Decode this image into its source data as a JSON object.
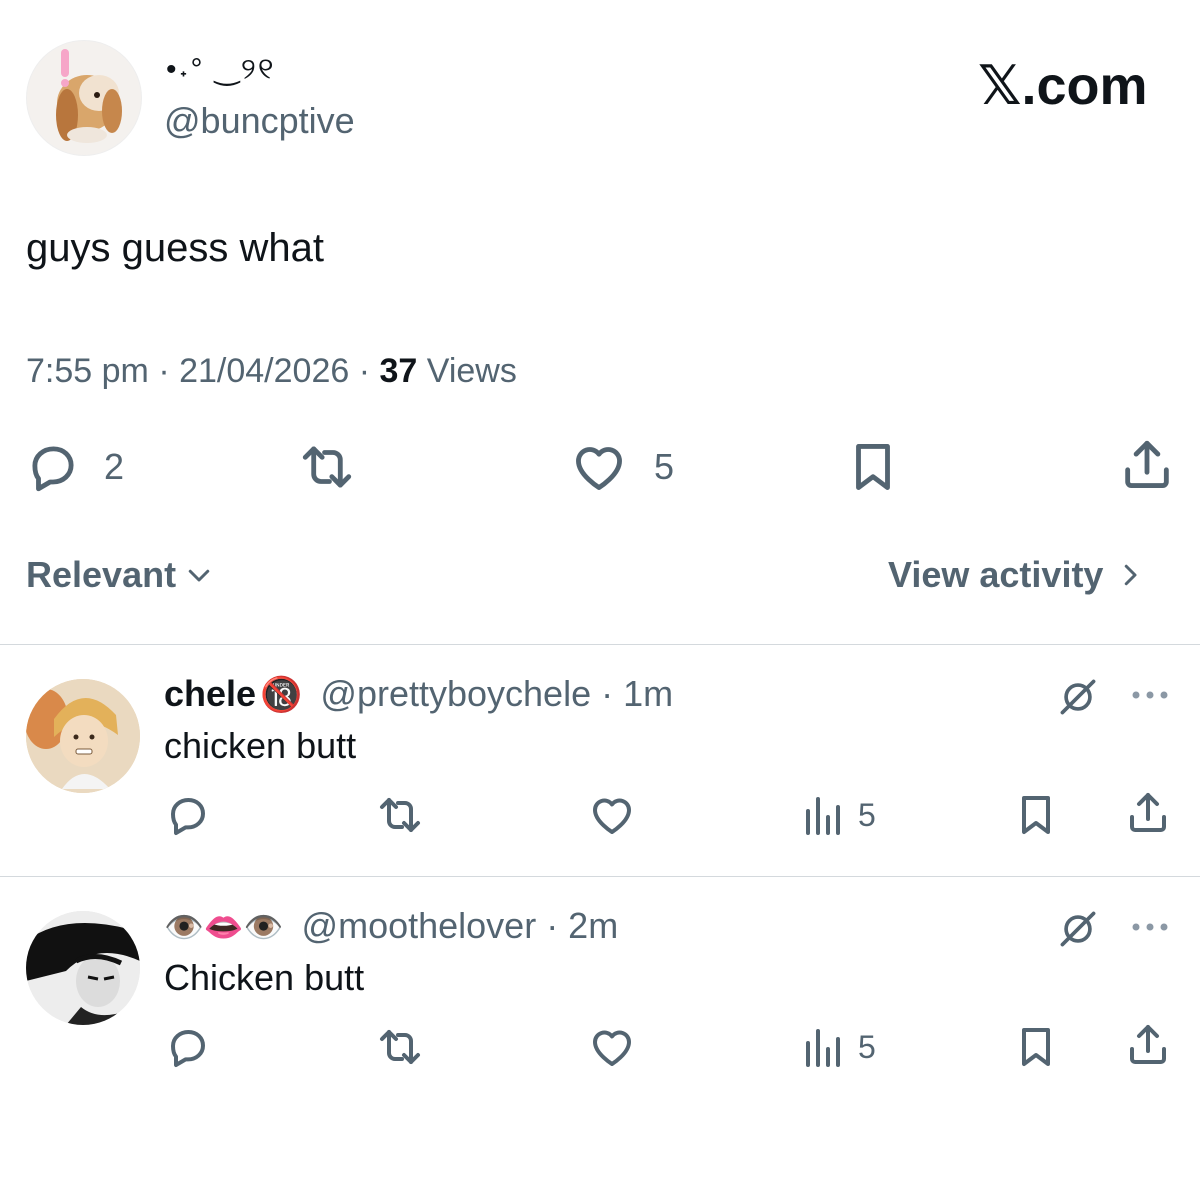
{
  "author": {
    "display_name": "•˖° ‿୨୧",
    "handle": "@buncptive"
  },
  "brand": {
    "logo_text": "𝕏.com"
  },
  "post": {
    "text": "guys guess what",
    "time": "7:55 pm",
    "date": "21/04/2026",
    "views_count": "37",
    "views_label": "Views",
    "separator": "·"
  },
  "actions": {
    "reply_count": "2",
    "like_count": "5"
  },
  "sort": {
    "label": "Relevant",
    "view_activity": "View activity"
  },
  "replies": [
    {
      "display_name": "chele",
      "badge": "🔞",
      "handle": "@prettyboychele",
      "age": "· 1m",
      "text": "chicken butt",
      "views": "5"
    },
    {
      "display_name": "👁️👄👁️",
      "badge": "",
      "handle": "@moothelover",
      "age": "· 2m",
      "text": "Chicken butt",
      "views": "5"
    }
  ],
  "icons": {
    "reply": "reply-icon",
    "retweet": "retweet-icon",
    "like": "heart-icon",
    "bookmark": "bookmark-icon",
    "share": "share-icon",
    "views": "views-icon",
    "grok": "grok-icon",
    "more": "more-icon",
    "chevron_down": "chevron-down-icon",
    "chevron_right": "chevron-right-icon"
  },
  "colors": {
    "text": "#0f1419",
    "secondary": "#536471",
    "divider": "#d4d9dd"
  }
}
